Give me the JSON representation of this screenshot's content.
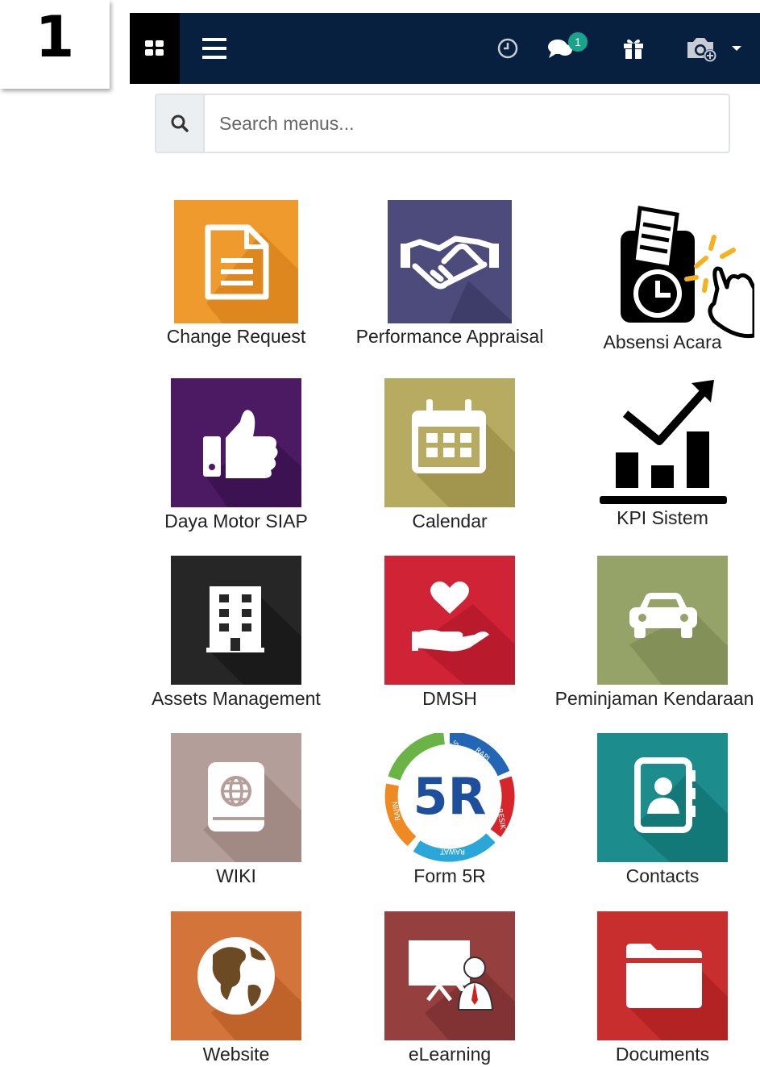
{
  "step_badge": {
    "number": "1"
  },
  "navbar": {
    "notification_count": "1",
    "icons": [
      "apps-grid-icon",
      "hamburger-menu-icon",
      "clock-icon",
      "chat-icon",
      "gift-icon",
      "camera-add-icon",
      "caret-down-icon"
    ]
  },
  "search": {
    "placeholder": "Search menus..."
  },
  "apps": [
    {
      "label": "Change Request",
      "icon": "document-icon",
      "color": "#ee9a2c"
    },
    {
      "label": "Performance Appraisal",
      "icon": "handshake-icon",
      "color": "#4c4b7b"
    },
    {
      "label": "Absensi Acara",
      "icon": "attendance-clock-icon",
      "color": "#ffffff"
    },
    {
      "label": "Daya Motor SIAP",
      "icon": "thumbs-up-icon",
      "color": "#4c1a63"
    },
    {
      "label": "Calendar",
      "icon": "calendar-icon",
      "color": "#b7ab61"
    },
    {
      "label": "KPI Sistem",
      "icon": "chart-growth-icon",
      "color": "#ffffff"
    },
    {
      "label": "Assets Management",
      "icon": "building-icon",
      "color": "#262626"
    },
    {
      "label": "DMSH",
      "icon": "heart-hand-icon",
      "color": "#d12336"
    },
    {
      "label": "Peminjaman Kendaraan",
      "icon": "car-icon",
      "color": "#95a369"
    },
    {
      "label": "WIKI",
      "icon": "globe-book-icon",
      "color": "#b49e9a"
    },
    {
      "label": "Form 5R",
      "icon": "5r-logo-icon",
      "color": "#ffffff"
    },
    {
      "label": "Contacts",
      "icon": "address-book-icon",
      "color": "#1c8c8c"
    },
    {
      "label": "Website",
      "icon": "earth-globe-icon",
      "color": "#d3743a"
    },
    {
      "label": "eLearning",
      "icon": "presentation-icon",
      "color": "#953f3f"
    },
    {
      "label": "Documents",
      "icon": "folder-icon",
      "color": "#c92e2e"
    }
  ],
  "form5r_logo": {
    "center_text": "5R",
    "ring_words": [
      "RINGKAS",
      "RAPI",
      "RESIK",
      "RAWAT",
      "RAJIN"
    ]
  }
}
